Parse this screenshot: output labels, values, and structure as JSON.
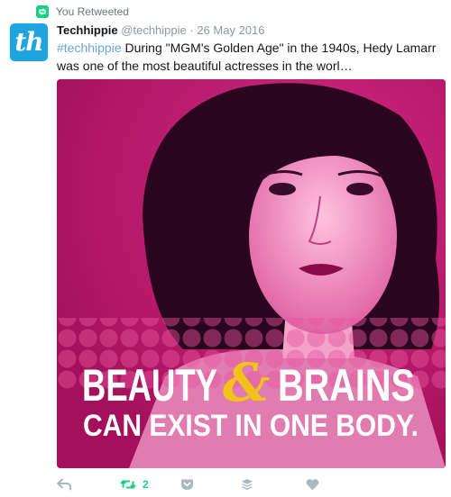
{
  "retweet_banner": {
    "text": "You Retweeted",
    "icon": "retweet-icon"
  },
  "tweet": {
    "author_initials": "th",
    "author_name": "Techhippie",
    "author_handle": "@techhippie",
    "separator": "·",
    "date": "26 May 2016",
    "hashtag": "#techhippie",
    "text": " During \"MGM's Golden Age\" in the 1940s, Hedy Lamarr was one of the most beautiful actresses in the worl…"
  },
  "media": {
    "headline_part1": "BEAUTY",
    "ampersand": "&",
    "headline_part2": "BRAINS",
    "subline": "CAN EXIST IN ONE BODY.",
    "tint_color": "#c2186e",
    "ampersand_color": "#f2c21b"
  },
  "actions": {
    "reply_icon": "reply-icon",
    "retweet_icon": "retweet-icon",
    "retweet_count": "2",
    "pocket_icon": "pocket-icon",
    "buffer_icon": "buffer-icon",
    "like_icon": "heart-icon",
    "accent": "#19cf86",
    "icon_color": "#aab8c2"
  }
}
